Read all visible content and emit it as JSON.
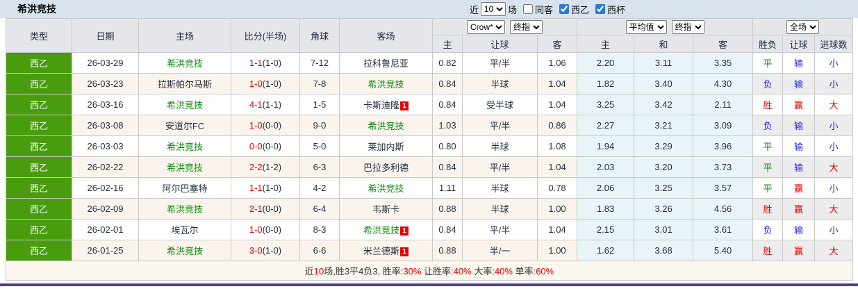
{
  "top_bar": {
    "title": "希洪竞技",
    "near_label": "近",
    "count_value": "10",
    "count_suffix": "场",
    "filters": [
      {
        "label": "同客",
        "checked": "false"
      },
      {
        "label": "西乙",
        "checked": "true"
      },
      {
        "label": "西杯",
        "checked": "true"
      }
    ]
  },
  "table": {
    "headers": {
      "type": "类型",
      "date": "日期",
      "home": "主场",
      "score": "比分(半场)",
      "corner": "角球",
      "away": "客场",
      "odds_home": "主",
      "odds_handicap": "让球",
      "odds_away": "客",
      "avg_home": "主",
      "avg_draw": "和",
      "avg_away": "客",
      "result": "胜负",
      "handicap_result": "让球",
      "goals": "进球数"
    },
    "selects": {
      "bookmaker": "Crow*",
      "bookmaker_stage": "终指",
      "average": "平均值",
      "average_stage": "终指",
      "scope": "全场"
    },
    "rows": [
      {
        "league": "西乙",
        "date": "26-03-29",
        "home": "希洪竞技",
        "home_hl": "y",
        "home_badge": "",
        "score": "1-1",
        "half": "(1-0)",
        "corner": "7-12",
        "away": "拉科鲁尼亚",
        "away_hl": "n",
        "away_badge": "",
        "let_home": "0.82",
        "handicap": "平/半",
        "let_away": "1.06",
        "avg_home": "2.20",
        "avg_draw": "3.11",
        "avg_away": "3.35",
        "result": "平",
        "result_c": "g",
        "let_result": "输",
        "let_c": "b",
        "goal": "小",
        "goal_c": "b"
      },
      {
        "league": "西乙",
        "date": "26-03-23",
        "home": "拉斯帕尔马斯",
        "home_hl": "n",
        "home_badge": "",
        "score": "1-0",
        "half": "(1-0)",
        "corner": "7-8",
        "away": "希洪竞技",
        "away_hl": "y",
        "away_badge": "",
        "let_home": "0.84",
        "handicap": "半球",
        "let_away": "1.04",
        "avg_home": "1.82",
        "avg_draw": "3.40",
        "avg_away": "4.30",
        "result": "负",
        "result_c": "b",
        "let_result": "输",
        "let_c": "b",
        "goal": "小",
        "goal_c": "b"
      },
      {
        "league": "西乙",
        "date": "26-03-16",
        "home": "希洪竞技",
        "home_hl": "y",
        "home_badge": "",
        "score": "4-1",
        "half": "(1-1)",
        "corner": "1-5",
        "away": "卡斯迪隆",
        "away_hl": "n",
        "away_badge": "1",
        "let_home": "0.84",
        "handicap": "受半球",
        "let_away": "1.04",
        "avg_home": "3.25",
        "avg_draw": "3.42",
        "avg_away": "2.11",
        "result": "胜",
        "result_c": "r",
        "let_result": "赢",
        "let_c": "r",
        "goal": "大",
        "goal_c": "r"
      },
      {
        "league": "西乙",
        "date": "26-03-08",
        "home": "安道尔FC",
        "home_hl": "n",
        "home_badge": "",
        "score": "1-0",
        "half": "(0-0)",
        "corner": "9-0",
        "away": "希洪竞技",
        "away_hl": "y",
        "away_badge": "",
        "let_home": "1.03",
        "handicap": "平/半",
        "let_away": "0.86",
        "avg_home": "2.27",
        "avg_draw": "3.21",
        "avg_away": "3.09",
        "result": "负",
        "result_c": "b",
        "let_result": "输",
        "let_c": "b",
        "goal": "小",
        "goal_c": "b"
      },
      {
        "league": "西乙",
        "date": "26-03-03",
        "home": "希洪竞技",
        "home_hl": "y",
        "home_badge": "",
        "score": "0-0",
        "half": "(0-0)",
        "corner": "5-0",
        "away": "莱加内斯",
        "away_hl": "n",
        "away_badge": "",
        "let_home": "0.80",
        "handicap": "半球",
        "let_away": "1.08",
        "avg_home": "1.94",
        "avg_draw": "3.29",
        "avg_away": "3.96",
        "result": "平",
        "result_c": "g",
        "let_result": "输",
        "let_c": "b",
        "goal": "小",
        "goal_c": "b"
      },
      {
        "league": "西乙",
        "date": "26-02-22",
        "home": "希洪竞技",
        "home_hl": "y",
        "home_badge": "",
        "score": "2-2",
        "half": "(1-2)",
        "corner": "6-3",
        "away": "巴拉多利德",
        "away_hl": "n",
        "away_badge": "",
        "let_home": "0.84",
        "handicap": "平/半",
        "let_away": "1.04",
        "avg_home": "2.03",
        "avg_draw": "3.20",
        "avg_away": "3.73",
        "result": "平",
        "result_c": "g",
        "let_result": "输",
        "let_c": "b",
        "goal": "大",
        "goal_c": "r"
      },
      {
        "league": "西乙",
        "date": "26-02-16",
        "home": "阿尔巴塞特",
        "home_hl": "n",
        "home_badge": "",
        "score": "1-1",
        "half": "(1-0)",
        "corner": "4-2",
        "away": "希洪竞技",
        "away_hl": "y",
        "away_badge": "",
        "let_home": "1.11",
        "handicap": "半球",
        "let_away": "0.78",
        "avg_home": "2.06",
        "avg_draw": "3.25",
        "avg_away": "3.57",
        "result": "平",
        "result_c": "g",
        "let_result": "赢",
        "let_c": "r",
        "goal": "小",
        "goal_c": "b"
      },
      {
        "league": "西乙",
        "date": "26-02-09",
        "home": "希洪竞技",
        "home_hl": "y",
        "home_badge": "",
        "score": "2-1",
        "half": "(0-0)",
        "corner": "6-4",
        "away": "韦斯卡",
        "away_hl": "n",
        "away_badge": "",
        "let_home": "0.88",
        "handicap": "半球",
        "let_away": "1.00",
        "avg_home": "1.83",
        "avg_draw": "3.26",
        "avg_away": "4.56",
        "result": "胜",
        "result_c": "r",
        "let_result": "赢",
        "let_c": "r",
        "goal": "大",
        "goal_c": "r"
      },
      {
        "league": "西乙",
        "date": "26-02-01",
        "home": "埃瓦尔",
        "home_hl": "n",
        "home_badge": "",
        "score": "1-0",
        "half": "(0-0)",
        "corner": "8-3",
        "away": "希洪竞技",
        "away_hl": "y",
        "away_badge": "1",
        "let_home": "0.84",
        "handicap": "平/半",
        "let_away": "1.04",
        "avg_home": "2.15",
        "avg_draw": "3.01",
        "avg_away": "3.61",
        "result": "负",
        "result_c": "b",
        "let_result": "输",
        "let_c": "b",
        "goal": "小",
        "goal_c": "b"
      },
      {
        "league": "西乙",
        "date": "26-01-25",
        "home": "希洪竞技",
        "home_hl": "y",
        "home_badge": "",
        "score": "3-0",
        "half": "(1-0)",
        "corner": "6-6",
        "away": "米兰德斯",
        "away_hl": "n",
        "away_badge": "1",
        "let_home": "0.88",
        "handicap": "半/一",
        "let_away": "1.00",
        "avg_home": "1.62",
        "avg_draw": "3.68",
        "avg_away": "5.40",
        "result": "胜",
        "result_c": "r",
        "let_result": "赢",
        "let_c": "r",
        "goal": "大",
        "goal_c": "r"
      }
    ]
  },
  "footer": {
    "parts": [
      {
        "text": "近",
        "color": "dark"
      },
      {
        "text": "10",
        "color": "red"
      },
      {
        "text": "场,胜3平4负3, 胜率:",
        "color": "dark"
      },
      {
        "text": "30%",
        "color": "red"
      },
      {
        "text": " 让胜率:",
        "color": "dark"
      },
      {
        "text": "40%",
        "color": "red"
      },
      {
        "text": " 大率:",
        "color": "dark"
      },
      {
        "text": "40%",
        "color": "red"
      },
      {
        "text": " 单率:",
        "color": "dark"
      },
      {
        "text": "60%",
        "color": "red"
      }
    ]
  },
  "colors": {
    "accent_green": "#489c0e",
    "highlight_team": "#0b8a0b",
    "red": "#e60000",
    "blue": "#2424d8",
    "topbar_bg": "#d9e3f0",
    "bottom_bar": "#4a3f90"
  }
}
